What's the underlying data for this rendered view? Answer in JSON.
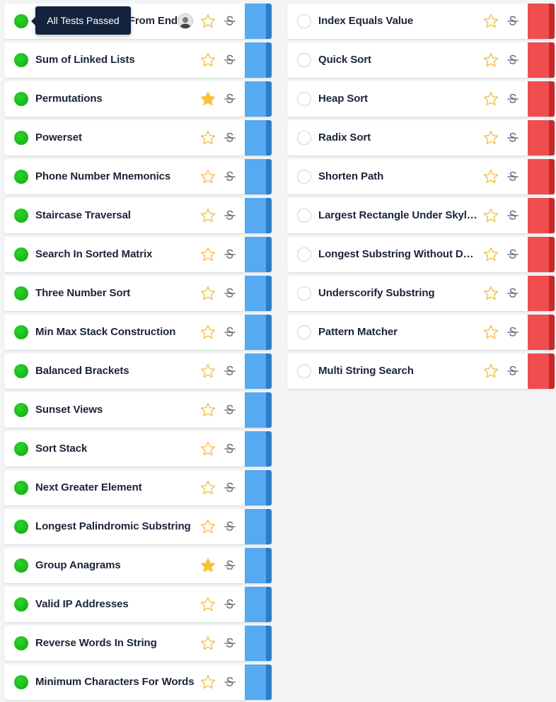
{
  "tooltip": {
    "text": "All Tests Passed"
  },
  "colors": {
    "complete": "#17b617",
    "star_active": "#f7c52a",
    "star_outline": "#f4c34d",
    "left_tab": "#55aaf2",
    "right_tab": "#ee4e4e"
  },
  "left_column": {
    "tab_color": "blue",
    "items": [
      {
        "title": "Remove Kth Node From End",
        "completed": true,
        "starred": false,
        "has_avatar": true
      },
      {
        "title": "Sum of Linked Lists",
        "completed": true,
        "starred": false
      },
      {
        "title": "Permutations",
        "completed": true,
        "starred": true
      },
      {
        "title": "Powerset",
        "completed": true,
        "starred": false
      },
      {
        "title": "Phone Number Mnemonics",
        "completed": true,
        "starred": false
      },
      {
        "title": "Staircase Traversal",
        "completed": true,
        "starred": false
      },
      {
        "title": "Search In Sorted Matrix",
        "completed": true,
        "starred": false
      },
      {
        "title": "Three Number Sort",
        "completed": true,
        "starred": false
      },
      {
        "title": "Min Max Stack Construction",
        "completed": true,
        "starred": false
      },
      {
        "title": "Balanced Brackets",
        "completed": true,
        "starred": false
      },
      {
        "title": "Sunset Views",
        "completed": true,
        "starred": false
      },
      {
        "title": "Sort Stack",
        "completed": true,
        "starred": false
      },
      {
        "title": "Next Greater Element",
        "completed": true,
        "starred": false
      },
      {
        "title": "Longest Palindromic Substring",
        "completed": true,
        "starred": false
      },
      {
        "title": "Group Anagrams",
        "completed": true,
        "starred": true
      },
      {
        "title": "Valid IP Addresses",
        "completed": true,
        "starred": false
      },
      {
        "title": "Reverse Words In String",
        "completed": true,
        "starred": false
      },
      {
        "title": "Minimum Characters For Words",
        "completed": true,
        "starred": false
      }
    ]
  },
  "right_column": {
    "tab_color": "red",
    "items": [
      {
        "title": "Index Equals Value",
        "completed": false,
        "starred": false
      },
      {
        "title": "Quick Sort",
        "completed": false,
        "starred": false
      },
      {
        "title": "Heap Sort",
        "completed": false,
        "starred": false
      },
      {
        "title": "Radix Sort",
        "completed": false,
        "starred": false
      },
      {
        "title": "Shorten Path",
        "completed": false,
        "starred": false
      },
      {
        "title": "Largest Rectangle Under Skyline",
        "completed": false,
        "starred": false
      },
      {
        "title": "Longest Substring Without Duplication",
        "completed": false,
        "starred": false
      },
      {
        "title": "Underscorify Substring",
        "completed": false,
        "starred": false
      },
      {
        "title": "Pattern Matcher",
        "completed": false,
        "starred": false
      },
      {
        "title": "Multi String Search",
        "completed": false,
        "starred": false
      }
    ]
  }
}
